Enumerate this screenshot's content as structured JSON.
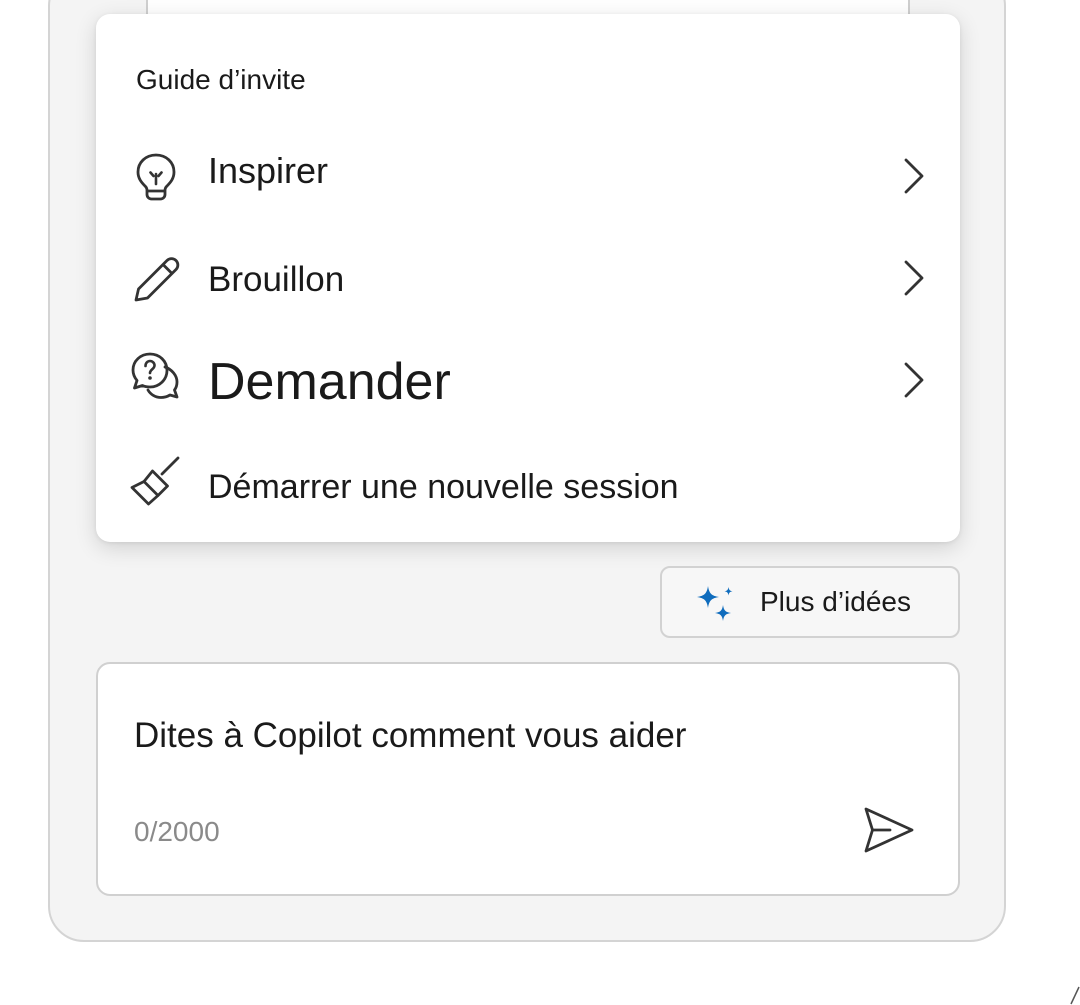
{
  "prompt_guide": {
    "title": "Guide d’invite",
    "items": [
      {
        "label": "Inspirer",
        "icon": "lightbulb-icon",
        "has_submenu": true
      },
      {
        "label": "Brouillon",
        "icon": "pencil-icon",
        "has_submenu": true
      },
      {
        "label": "Demander",
        "icon": "question-chat-icon",
        "has_submenu": true
      },
      {
        "label": "Démarrer une nouvelle session",
        "icon": "broom-icon",
        "has_submenu": false
      }
    ]
  },
  "more_ideas": {
    "label": "Plus d’idées",
    "icon": "sparkle-icon",
    "icon_color": "#0f6cbd"
  },
  "composer": {
    "placeholder": "Dites à Copilot comment vous aider",
    "counter": "0/2000",
    "send_icon": "send-icon"
  }
}
